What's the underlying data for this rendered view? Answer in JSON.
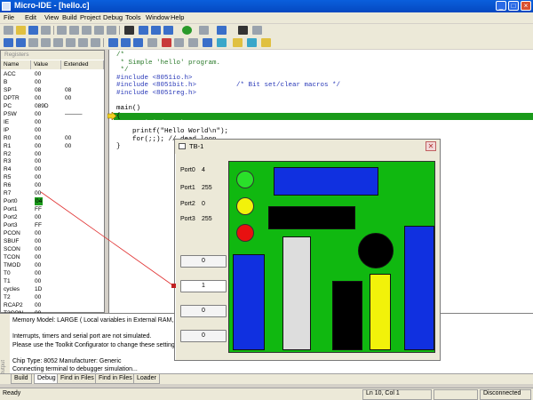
{
  "window": {
    "title": "Micro-IDE - [hello.c]",
    "controls": [
      "_",
      "□",
      "×"
    ]
  },
  "menu": [
    "File",
    "Edit",
    "View",
    "Build",
    "Project",
    "Debug",
    "Tools",
    "Window",
    "Help"
  ],
  "registers": {
    "caption": "Registers",
    "headers": [
      "Name",
      "Value",
      "Extended"
    ],
    "rows": [
      {
        "name": "ACC",
        "value": "00",
        "ext": ""
      },
      {
        "name": "B",
        "value": "00",
        "ext": ""
      },
      {
        "name": "SP",
        "value": "08",
        "ext": "08"
      },
      {
        "name": "DPTR",
        "value": "00",
        "ext": "00"
      },
      {
        "name": "PC",
        "value": "089D",
        "ext": ""
      },
      {
        "name": "PSW",
        "value": "00",
        "ext": "———"
      },
      {
        "name": "IE",
        "value": "00",
        "ext": ""
      },
      {
        "name": "IP",
        "value": "00",
        "ext": ""
      },
      {
        "name": "R0",
        "value": "00",
        "ext": "00"
      },
      {
        "name": "R1",
        "value": "00",
        "ext": "00"
      },
      {
        "name": "R2",
        "value": "00",
        "ext": ""
      },
      {
        "name": "R3",
        "value": "00",
        "ext": ""
      },
      {
        "name": "R4",
        "value": "00",
        "ext": ""
      },
      {
        "name": "R5",
        "value": "00",
        "ext": ""
      },
      {
        "name": "R6",
        "value": "00",
        "ext": ""
      },
      {
        "name": "R7",
        "value": "00",
        "ext": ""
      },
      {
        "name": "Port0",
        "value": "04",
        "ext": ""
      },
      {
        "name": "Port1",
        "value": "FF",
        "ext": ""
      },
      {
        "name": "Port2",
        "value": "00",
        "ext": ""
      },
      {
        "name": "Port3",
        "value": "FF",
        "ext": ""
      },
      {
        "name": "PCON",
        "value": "00",
        "ext": ""
      },
      {
        "name": "SBUF",
        "value": "00",
        "ext": ""
      },
      {
        "name": "SCON",
        "value": "00",
        "ext": ""
      },
      {
        "name": "TCON",
        "value": "00",
        "ext": ""
      },
      {
        "name": "TMOD",
        "value": "00",
        "ext": ""
      },
      {
        "name": "T0",
        "value": "00",
        "ext": ""
      },
      {
        "name": "T1",
        "value": "00",
        "ext": ""
      },
      {
        "name": "cycles",
        "value": "1D",
        "ext": ""
      },
      {
        "name": "T2",
        "value": "00",
        "ext": ""
      },
      {
        "name": "RCAP2",
        "value": "00",
        "ext": ""
      },
      {
        "name": "T2CON",
        "value": "00",
        "ext": ""
      }
    ]
  },
  "editor": {
    "lines": [
      {
        "text": "/*",
        "kind": "com"
      },
      {
        "text": " * Simple 'hello' program.",
        "kind": "com"
      },
      {
        "text": " */",
        "kind": "com"
      },
      {
        "text": "#include <8051io.h>",
        "kind": "pp"
      },
      {
        "text": "#include <8051bit.h>          /* Bit set/clear macros */",
        "kind": "pp"
      },
      {
        "text": "#include <8051reg.h>",
        "kind": "pp"
      },
      {
        "text": "",
        "kind": "plain"
      },
      {
        "text": "main()",
        "kind": "plain"
      },
      {
        "text": "{",
        "kind": "plain"
      },
      {
        "text": "    serinit(9600);",
        "kind": "cur"
      },
      {
        "text": "    printf(\"Hello World\\n\");",
        "kind": "plain"
      },
      {
        "text": "    for(;;); // dead loop",
        "kind": "plain"
      },
      {
        "text": "}",
        "kind": "plain"
      }
    ]
  },
  "dialog": {
    "title": "TB-1",
    "ports": [
      {
        "label": "Port0",
        "value": "4"
      },
      {
        "label": "Port1",
        "value": "255"
      },
      {
        "label": "Port2",
        "value": "0"
      },
      {
        "label": "Port3",
        "value": "255"
      }
    ],
    "buttons": [
      "0",
      "1",
      "0",
      "0"
    ],
    "leds": [
      "#2ae02a",
      "#f2f20a",
      "#e81010"
    ],
    "board_color": "#10b810"
  },
  "output": {
    "lines": [
      "Memory Model: LARGE ( Local variables in External RAM, separa",
      "",
      "Interrupts, timers and serial port are not simulated.",
      "Please use the Toolkit Configurator to change these settings if r",
      "",
      "Chip Type: 8052 Manufacturer: Generic",
      "Connecting terminal to debugger simulation..."
    ],
    "side_caption": "Output"
  },
  "tabs": [
    "Build",
    "Debug",
    "Find in Files 1",
    "Find in Files 2",
    "Loader"
  ],
  "active_tab": "Debug",
  "status": {
    "left": "Ready",
    "position": "Ln 10, Col 1",
    "state": "Disconnected"
  }
}
